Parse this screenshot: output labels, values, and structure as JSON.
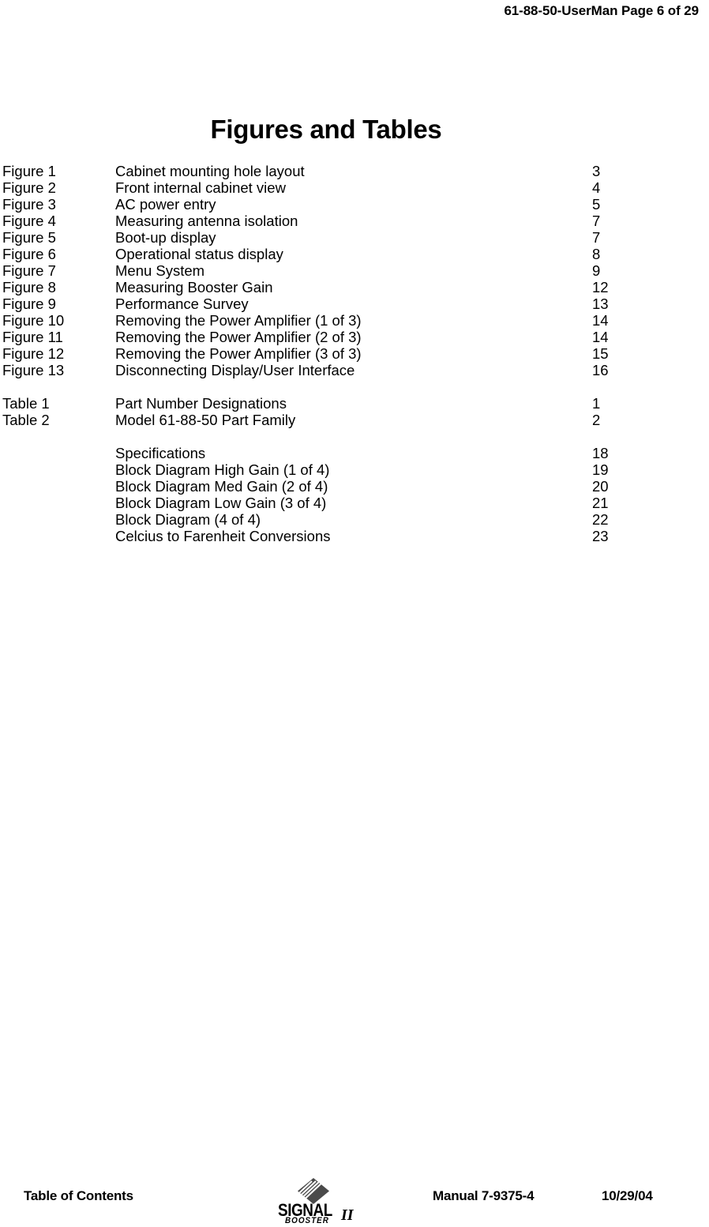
{
  "header": {
    "text": "61-88-50-UserMan Page 6 of 29"
  },
  "title": "Figures and Tables",
  "toc": {
    "figures": [
      {
        "label": "Figure 1",
        "desc": "Cabinet mounting hole layout",
        "page": "3"
      },
      {
        "label": "Figure 2",
        "desc": "Front internal cabinet view",
        "page": "4"
      },
      {
        "label": "Figure 3",
        "desc": "AC power entry",
        "page": "5"
      },
      {
        "label": "Figure 4",
        "desc": "Measuring antenna isolation",
        "page": "7"
      },
      {
        "label": "Figure 5",
        "desc": "Boot-up display",
        "page": "7"
      },
      {
        "label": "Figure 6",
        "desc": "Operational status display",
        "page": "8"
      },
      {
        "label": "Figure 7",
        "desc": "Menu System",
        "page": "9"
      },
      {
        "label": "Figure 8",
        "desc": "Measuring Booster Gain",
        "page": "12"
      },
      {
        "label": "Figure 9",
        "desc": "Performance Survey",
        "page": "13"
      },
      {
        "label": "Figure 10",
        "desc": "Removing the Power Amplifier (1 of 3)",
        "page": "14"
      },
      {
        "label": "Figure 11",
        "desc": "Removing the Power Amplifier (2 of 3)",
        "page": "14"
      },
      {
        "label": "Figure 12",
        "desc": "Removing the Power Amplifier (3 of 3)",
        "page": "15"
      },
      {
        "label": "Figure 13",
        "desc": "Disconnecting Display/User Interface",
        "page": "16"
      }
    ],
    "tables": [
      {
        "label": "Table 1",
        "desc": "Part Number Designations",
        "page": "1"
      },
      {
        "label": "Table 2",
        "desc": "Model 61-88-50 Part Family",
        "page": "2"
      }
    ],
    "appendices": [
      {
        "label": "",
        "desc": "Specifications",
        "page": "18"
      },
      {
        "label": "",
        "desc": "Block Diagram High Gain (1 of 4)",
        "page": "19"
      },
      {
        "label": "",
        "desc": "Block Diagram Med Gain (2 of 4)",
        "page": "20"
      },
      {
        "label": "",
        "desc": "Block Diagram Low Gain (3 of 4)",
        "page": "21"
      },
      {
        "label": "",
        "desc": "Block Diagram (4 of 4)",
        "page": "22"
      },
      {
        "label": "",
        "desc": "Celcius to Farenheit Conversions",
        "page": "23"
      }
    ]
  },
  "footer": {
    "section": "Table of Contents",
    "manual": "Manual 7-9375-4",
    "date": "10/29/04",
    "logo": {
      "brand": "SIGNAL",
      "product": "BOOSTER",
      "version": "II"
    }
  },
  "colors": {
    "text": "#000000",
    "background": "#ffffff",
    "logo_mark": "#4a4a4a"
  }
}
